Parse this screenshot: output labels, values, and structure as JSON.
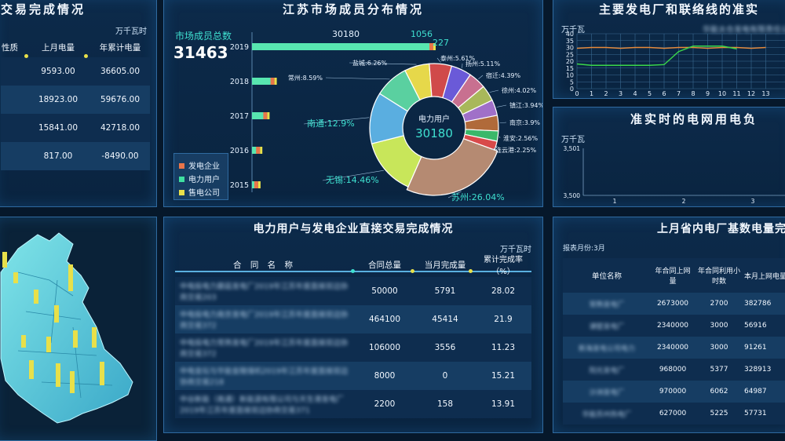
{
  "p1": {
    "title": "交易完成情况",
    "unit": "万千瓦时",
    "headers": [
      "性质",
      "上月电量",
      "年累计电量"
    ],
    "rows": [
      {
        "last_month": "9593.00",
        "ytd": "36605.00"
      },
      {
        "last_month": "18923.00",
        "ytd": "59676.00"
      },
      {
        "last_month": "15841.00",
        "ytd": "42718.00"
      },
      {
        "last_month": "817.00",
        "ytd": "-8490.00"
      }
    ]
  },
  "p2": {
    "title": "江苏市场成员分布情况",
    "total_label": "市场成员总数",
    "total_value": "31463",
    "years": [
      "2019",
      "2018",
      "2017",
      "2016",
      "2015"
    ],
    "bar_fractions": [
      1.0,
      0.12,
      0.08,
      0.04,
      0.03
    ],
    "bar_labels": {
      "users": "30180",
      "gen": "1056",
      "sell": "227"
    },
    "legend": [
      "发电企业",
      "电力用户",
      "售电公司"
    ],
    "legend_colors": [
      "#e8754a",
      "#3fe0a0",
      "#e8e04a"
    ],
    "donut_center_label": "电力用户",
    "donut_center_value": "30180",
    "slices": [
      {
        "label": "苏州:26.04%",
        "value": 26.04,
        "color": "#b58a72"
      },
      {
        "label": "无锡:14.46%",
        "value": 14.46,
        "color": "#c8e65a"
      },
      {
        "label": "南通:12.9%",
        "value": 12.9,
        "color": "#5aaee0"
      },
      {
        "label": "常州:8.59%",
        "value": 8.59,
        "color": "#5ad0a0"
      },
      {
        "label": "盐城:6.26%",
        "value": 6.26,
        "color": "#e6d84a"
      },
      {
        "label": "泰州:5.61%",
        "value": 5.61,
        "color": "#d04a4a"
      },
      {
        "label": "扬州:5.11%",
        "value": 5.11,
        "color": "#6a5ad8"
      },
      {
        "label": "宿迁:4.39%",
        "value": 4.39,
        "color": "#c87090"
      },
      {
        "label": "徐州:4.02%",
        "value": 4.02,
        "color": "#a8b85a"
      },
      {
        "label": "镇江:3.94%",
        "value": 3.94,
        "color": "#a070c8"
      },
      {
        "label": "南京:3.9%",
        "value": 3.9,
        "color": "#b06a3a"
      },
      {
        "label": "淮安:2.56%",
        "value": 2.56,
        "color": "#3ab86a"
      },
      {
        "label": "连云港:2.25%",
        "value": 2.25,
        "color": "#d84a4a"
      }
    ]
  },
  "p3": {
    "title": "主要发电厂和联络线的准实",
    "unit": "万千瓦",
    "subtitle_blur": "华能太仓发电有限责任公",
    "yticks": [
      "40",
      "35",
      "30",
      "25",
      "20",
      "15",
      "10",
      "5",
      "0"
    ],
    "xticks": [
      "0",
      "1",
      "2",
      "3",
      "4",
      "5",
      "6",
      "7",
      "8",
      "9",
      "10",
      "11",
      "12",
      "13"
    ]
  },
  "p4": {
    "title": "准实时的电网用电负",
    "unit": "万千瓦",
    "yticks": [
      "3,501",
      "3,500"
    ],
    "xticks": [
      "1",
      "2",
      "3"
    ]
  },
  "p6": {
    "title": "电力用户与发电企业直接交易完成情况",
    "unit": "万千瓦时",
    "headers": [
      "合 同 名 称",
      "合同总量",
      "当月完成量",
      "累计完成率（%）"
    ],
    "rows": [
      {
        "name": "中电投电力蘑菇发电厂2019年江苏年度直接双边协商交易203",
        "total": "50000",
        "month": "5791",
        "rate": "28.02"
      },
      {
        "name": "中电投电力南京发电厂2019年江苏年度直接双边协商交易372",
        "total": "464100",
        "month": "45414",
        "rate": "21.9"
      },
      {
        "name": "中电投电力常熟发电厂2019年江苏年度直接双边协商交易372",
        "total": "106000",
        "month": "3556",
        "rate": "11.23"
      },
      {
        "name": "中电金坛与华能金陵煤机2019年江苏年度直接双边协商交易218",
        "total": "8000",
        "month": "0",
        "rate": "15.21"
      },
      {
        "name": "中谷新能（南通）新能源有限公司与天生港发电厂2019年江苏年度直接双边协商交易371",
        "total": "2200",
        "month": "158",
        "rate": "13.91"
      }
    ]
  },
  "p7": {
    "title": "上月省内电厂基数电量完",
    "report_month": "报表月份:3月",
    "headers": [
      "单位名称",
      "年合同上网量",
      "年合同利用小时数",
      "本月上网电量"
    ],
    "rows": [
      {
        "name": "常熟发电厂",
        "c1": "2673000",
        "c2": "2700",
        "c3": "382786"
      },
      {
        "name": "谏壁发电厂",
        "c1": "2340000",
        "c2": "3000",
        "c3": "56916"
      },
      {
        "name": "新海发电公司电力",
        "c1": "2340000",
        "c2": "3000",
        "c3": "91261"
      },
      {
        "name": "阳光发电厂",
        "c1": "968000",
        "c2": "5377",
        "c3": "328913"
      },
      {
        "name": "沙洲发电厂",
        "c1": "970000",
        "c2": "6062",
        "c3": "64987"
      },
      {
        "name": "华能苏州热电厂",
        "c1": "627000",
        "c2": "5225",
        "c3": "57731"
      }
    ]
  }
}
